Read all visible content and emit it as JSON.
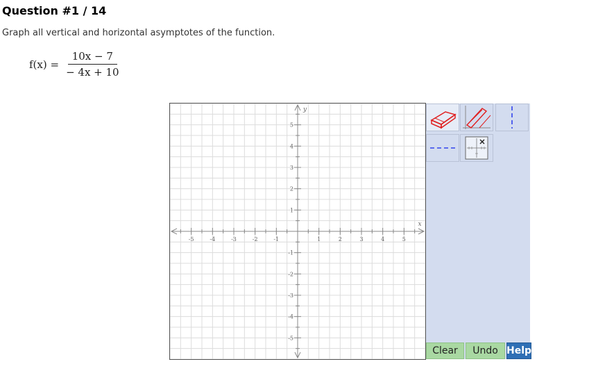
{
  "question": {
    "title": "Question #1 / 14",
    "prompt": "Graph all vertical and horizontal asymptotes of the function."
  },
  "formula": {
    "lhs": "f(x) =",
    "numerator": "10x − 7",
    "denominator": "− 4x + 10"
  },
  "graph": {
    "x_axis_label": "x",
    "y_axis_label": "y",
    "x_range": [
      -6,
      6
    ],
    "y_range": [
      -6,
      6
    ],
    "x_tick_labels": [
      "-5",
      "-4",
      "-3",
      "-2",
      "-1",
      "1",
      "2",
      "3",
      "4",
      "5"
    ],
    "y_tick_labels": [
      "5",
      "4",
      "3",
      "2",
      "1",
      "-1",
      "-2",
      "-3",
      "-4",
      "-5"
    ],
    "grid": true,
    "colors": {
      "grid": "#dcdcdc",
      "axis": "#888888"
    }
  },
  "tools": [
    {
      "name": "eraser-tool-button",
      "icon": "eraser-icon",
      "color": "#e02020"
    },
    {
      "name": "pencil-tool-button",
      "icon": "pencil-icon",
      "color": "#e02020"
    },
    {
      "name": "vertical-asymptote-tool-button",
      "icon": "vertical-dashed-line-icon",
      "color": "#3344ee"
    },
    {
      "name": "horizontal-asymptote-tool-button",
      "icon": "horizontal-dashed-line-icon",
      "color": "#3344ee"
    },
    {
      "name": "no-solution-tool-button",
      "icon": "grid-x-icon",
      "color": "#444444"
    }
  ],
  "buttons": {
    "clear": "Clear",
    "undo": "Undo",
    "help": "Help"
  },
  "colors": {
    "panel_bg": "#d3dcef",
    "action_green": "#a9d8a2",
    "help_blue": "#2f6fb5"
  }
}
